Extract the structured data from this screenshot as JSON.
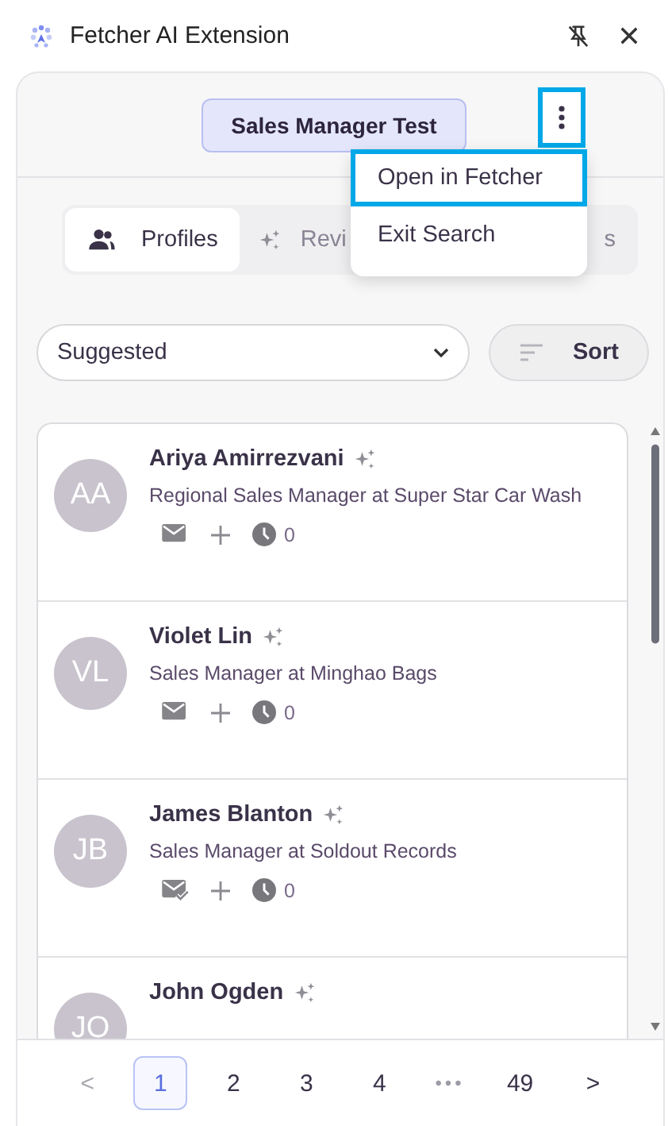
{
  "window": {
    "title": "Fetcher AI Extension"
  },
  "search": {
    "title": "Sales Manager Test",
    "menu_highlighted": true
  },
  "menu": {
    "items": [
      {
        "label": "Open in Fetcher",
        "highlighted": true
      },
      {
        "label": "Exit Search",
        "highlighted": false
      }
    ]
  },
  "tabs": [
    {
      "label": "Profiles",
      "selected": true
    },
    {
      "label": "Revi",
      "selected": false
    },
    {
      "label": "s",
      "selected": false
    }
  ],
  "filter": {
    "value": "Suggested"
  },
  "sort": {
    "label": "Sort"
  },
  "profiles": [
    {
      "initials": "AA",
      "name": "Ariya Amirrezvani",
      "title": "Regional Sales Manager at Super Star Car Wash",
      "email_verified": false,
      "count": "0"
    },
    {
      "initials": "VL",
      "name": "Violet Lin",
      "title": "Sales Manager at Minghao Bags",
      "email_verified": false,
      "count": "0"
    },
    {
      "initials": "JB",
      "name": "James Blanton",
      "title": "Sales Manager at Soldout Records",
      "email_verified": true,
      "count": "0"
    },
    {
      "initials": "JO",
      "name": "John Ogden"
    }
  ],
  "pagination": {
    "prev_disabled": true,
    "pages": [
      {
        "label": "1",
        "selected": true
      },
      {
        "label": "2",
        "selected": false
      },
      {
        "label": "3",
        "selected": false
      },
      {
        "label": "4",
        "selected": false
      },
      {
        "label": "•••",
        "kind": "ellipsis"
      },
      {
        "label": "49",
        "selected": false
      }
    ],
    "next": ">",
    "prev": "<"
  }
}
